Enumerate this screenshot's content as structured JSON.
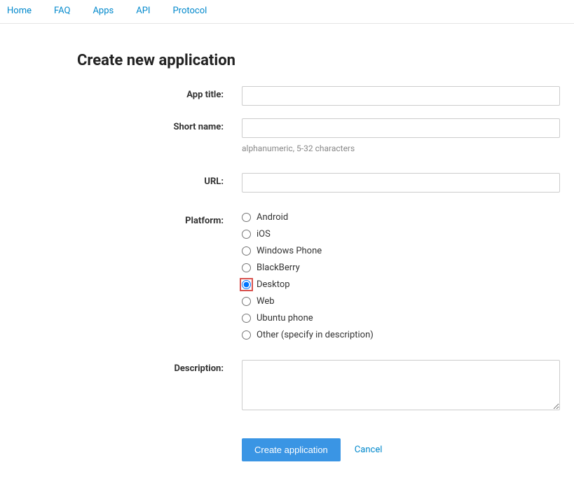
{
  "nav": {
    "home": "Home",
    "faq": "FAQ",
    "apps": "Apps",
    "api": "API",
    "protocol": "Protocol"
  },
  "page": {
    "title": "Create new application"
  },
  "form": {
    "app_title": {
      "label": "App title:",
      "value": ""
    },
    "short_name": {
      "label": "Short name:",
      "value": "",
      "hint": "alphanumeric, 5-32 characters"
    },
    "url": {
      "label": "URL:",
      "value": ""
    },
    "platform": {
      "label": "Platform:",
      "options": [
        {
          "value": "android",
          "label": "Android"
        },
        {
          "value": "ios",
          "label": "iOS"
        },
        {
          "value": "wp",
          "label": "Windows Phone"
        },
        {
          "value": "bb",
          "label": "BlackBerry"
        },
        {
          "value": "desktop",
          "label": "Desktop"
        },
        {
          "value": "web",
          "label": "Web"
        },
        {
          "value": "ubuntu",
          "label": "Ubuntu phone"
        },
        {
          "value": "other",
          "label": "Other (specify in description)"
        }
      ],
      "selected": "desktop"
    },
    "description": {
      "label": "Description:",
      "value": ""
    },
    "submit_label": "Create application",
    "cancel_label": "Cancel"
  }
}
